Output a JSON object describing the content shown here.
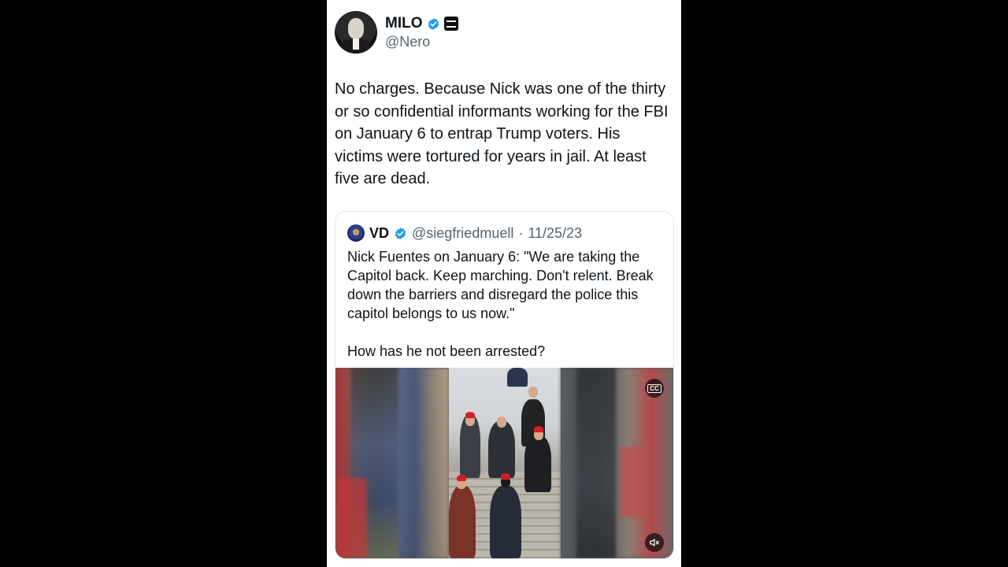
{
  "tweet": {
    "display_name": "MILO",
    "handle": "@Nero",
    "text": "No charges. Because Nick was one of the thirty or so confidential informants working for the FBI on January 6 to entrap Trump voters. His victims were tortured for years in jail. At least five are dead.",
    "verified": true,
    "icons": {
      "avatar": "profile-photo",
      "verified": "verified-badge-icon",
      "affiliation": "affiliation-badge-icon"
    }
  },
  "quote": {
    "display_name": "VD",
    "handle": "@siegfriedmuell",
    "separator": "·",
    "date": "11/25/23",
    "text": "Nick Fuentes on January 6: \"We are taking the Capitol back.  Keep marching.  Don't relent.  Break down the barriers and disregard the police this capitol belongs to us now.\"\n\nHow has he not been arrested?",
    "media": {
      "type": "video",
      "captions_label": "CC",
      "icons": {
        "captions": "closed-captions-icon",
        "mute": "speaker-muted-icon"
      }
    }
  },
  "colors": {
    "background": "#000000",
    "card": "#ffffff",
    "verified_blue": "#1d9bf0",
    "secondary_text": "#536471",
    "primary_text": "#0f1419"
  }
}
